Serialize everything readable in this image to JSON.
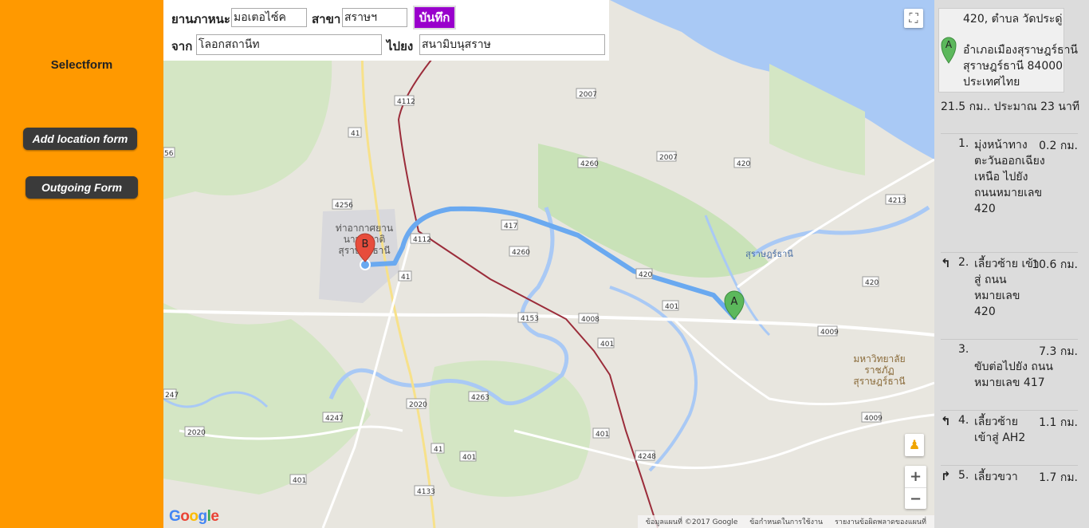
{
  "sidebar": {
    "title": "Selectform",
    "buttons": [
      {
        "label": "Add location form"
      },
      {
        "label": "Outgoing Form"
      }
    ]
  },
  "form": {
    "vehicle_label": "ยานภาหนะ",
    "vehicle_value": "มอเตอไซ์ค",
    "branch_label": "สาขา",
    "branch_value": "สราษฯ",
    "save_label": "บันทึก",
    "from_label": "จาก",
    "from_value": "โลอกสถานีท",
    "to_label": "ไปยง",
    "to_value": "สนามิบนุสราษ"
  },
  "map": {
    "route_color": "#6aa9f0",
    "marker_a_label": "A",
    "marker_b_label": "B",
    "place_labels": [
      {
        "text": "ท่าอากาศยาน"
      },
      {
        "text": "นานาชาติ"
      },
      {
        "text": "สุราษฎร์ธานี"
      },
      {
        "text": "สุราษฎร์ธานี"
      },
      {
        "text": "มหาวิทยาลัย"
      },
      {
        "text": "ราชภัฏ"
      },
      {
        "text": "สุราษฎร์ธานี"
      }
    ],
    "road_labels": [
      "4112",
      "2007",
      "41",
      "4260",
      "2007",
      "420",
      "4213",
      "4256",
      "4112",
      "417",
      "4260",
      "41",
      "420",
      "401",
      "420",
      "4153",
      "4008",
      "401",
      "4009",
      "247",
      "4263",
      "2020",
      "4247",
      "2020",
      "41",
      "401",
      "4248",
      "4009",
      "401",
      "4133",
      "401",
      "56"
    ],
    "logo": "Google",
    "attribution": [
      "ข้อมูลแผนที่ ©2017 Google",
      "ข้อกำหนดในการใช้งาน",
      "รายงานข้อผิดพลาดของแผนที่"
    ],
    "controls": {
      "fullscreen_icon": "fullscreen-icon",
      "pegman_icon": "pegman-icon",
      "zoom_in": "+",
      "zoom_out": "−"
    }
  },
  "directions": {
    "start_address_line1": "420, ตำบล วัดประดู่",
    "start_address_rest": "อำเภอเมืองสุราษฎร์ธานี สุราษฎร์ธานี 84000 ประเทศไทย",
    "marker_label": "A",
    "summary": "21.5 กม.. ประมาณ 23 นาที",
    "steps": [
      {
        "num": "1.",
        "icon": "",
        "text": "มุ่งหน้าทาง ตะวันออกเฉียงเหนือ ไปยัง ถนนหมายเลข 420",
        "dist": "0.2 กม."
      },
      {
        "num": "2.",
        "icon": "↰",
        "text": "เลี้ยวซ้าย เข้าสู่ ถนนหมายเลข 420",
        "dist": "10.6 กม."
      },
      {
        "num": "3.",
        "icon": "",
        "text": "ขับต่อไปยัง ถนนหมายเลข 417",
        "dist": "7.3 กม."
      },
      {
        "num": "4.",
        "icon": "↰",
        "text": "เลี้ยวซ้าย เข้าสู่ AH2",
        "dist": "1.1 กม."
      },
      {
        "num": "5.",
        "icon": "↱",
        "text": "เลี้ยวขวา",
        "dist": "1.7 กม."
      }
    ]
  }
}
